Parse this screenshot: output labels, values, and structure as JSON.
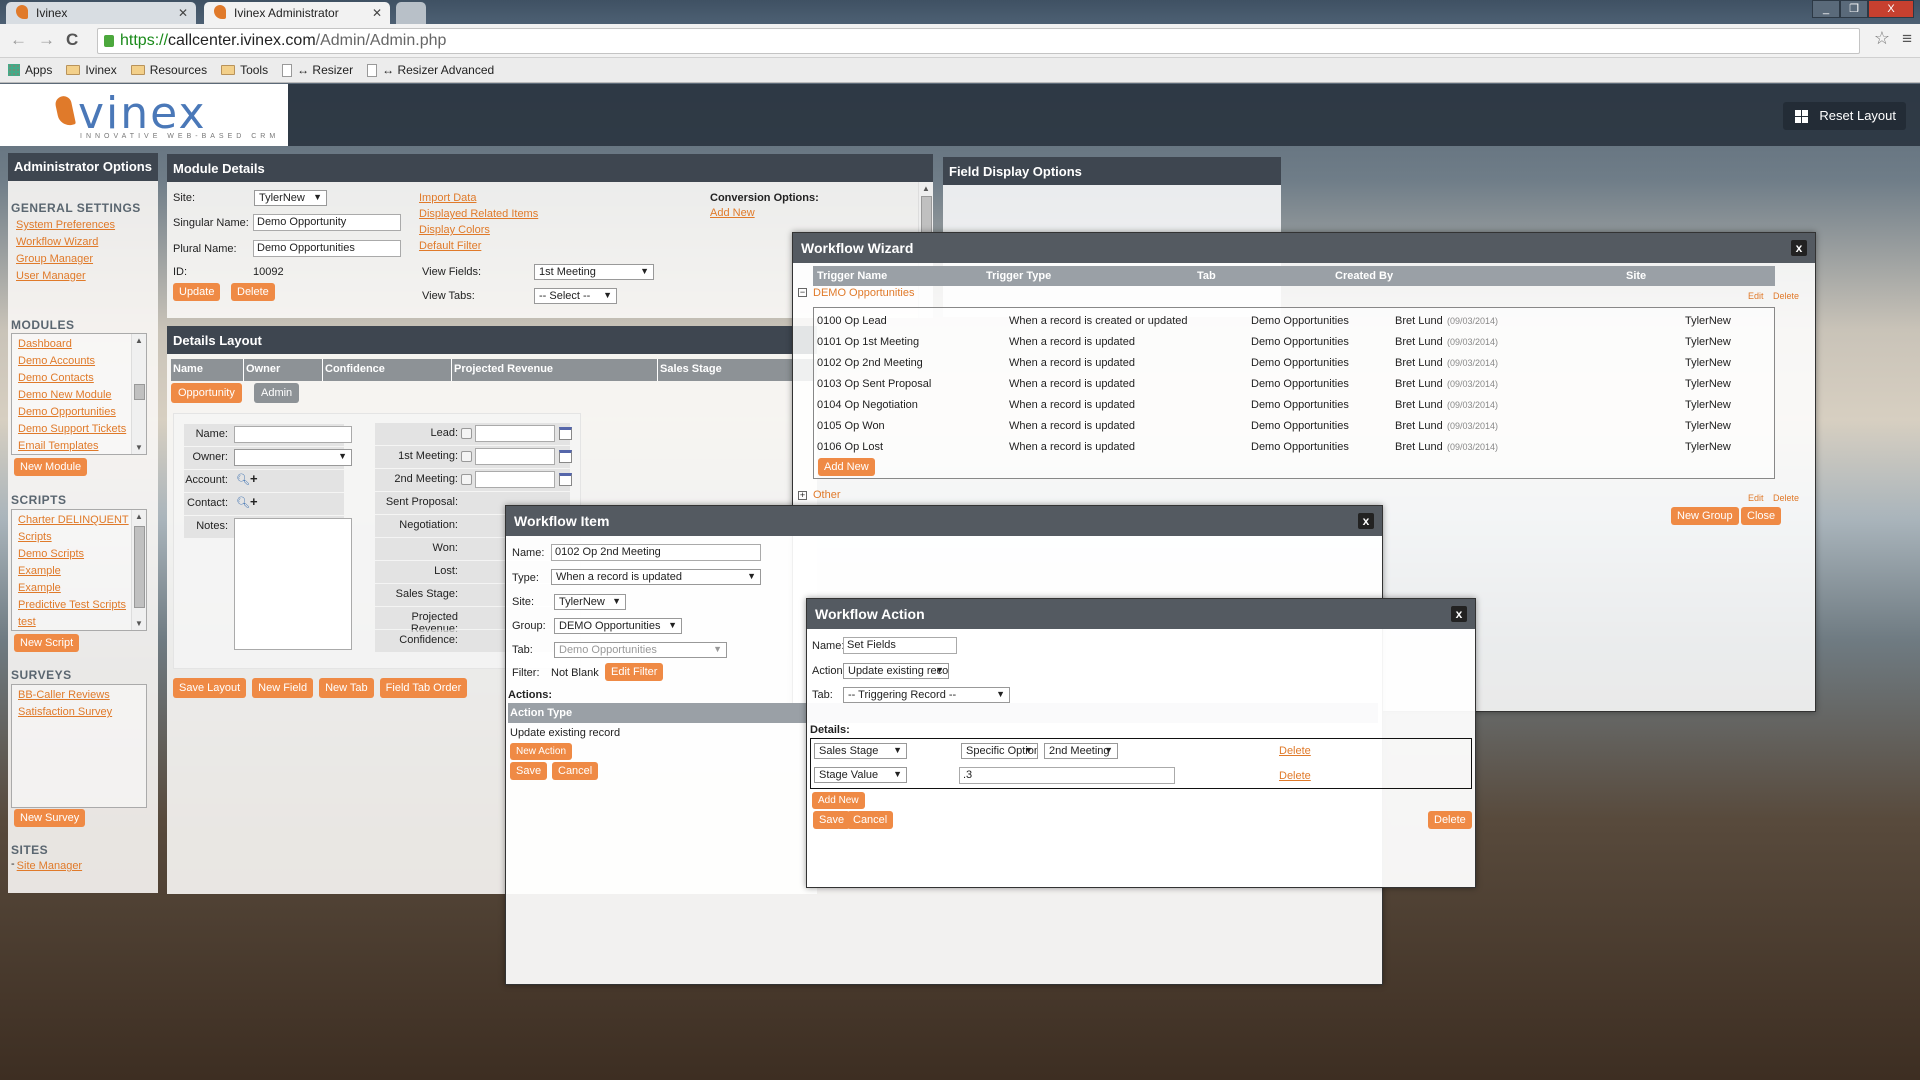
{
  "browser": {
    "tabs": [
      {
        "title": "Ivinex",
        "active": false
      },
      {
        "title": "Ivinex Administrator",
        "active": true
      }
    ],
    "url_scheme": "https://",
    "url_host": "callcenter.ivinex.com",
    "url_path": "/Admin/Admin.php",
    "bookmarks": [
      "Apps",
      "Ivinex",
      "Resources",
      "Tools",
      "↔ Resizer",
      "↔ Resizer Advanced"
    ],
    "window_buttons": [
      "_",
      "❐",
      "X"
    ]
  },
  "header": {
    "logo_word": "vinex",
    "logo_tagline": "INNOVATIVE WEB-BASED CRM",
    "reset_layout": "Reset Layout"
  },
  "sidebar": {
    "title": "Administrator Options",
    "general_title": "GENERAL SETTINGS",
    "general": [
      "System Preferences",
      "Workflow Wizard",
      "Group Manager",
      "User Manager"
    ],
    "modules_title": "MODULES",
    "modules": [
      "Dashboard",
      "Demo Accounts",
      "Demo Contacts",
      "Demo New Module",
      "Demo Opportunities",
      "Demo Support Tickets",
      "Email Templates"
    ],
    "new_module": "New Module",
    "scripts_title": "SCRIPTS",
    "scripts": [
      "Charter DELINQUENT",
      "Scripts",
      "Demo Scripts",
      "Example",
      "Example",
      "Predictive Test Scripts",
      "test"
    ],
    "new_script": "New Script",
    "surveys_title": "SURVEYS",
    "surveys": [
      "BB-Caller Reviews",
      "Satisfaction Survey"
    ],
    "new_survey": "New Survey",
    "sites_title": "SITES",
    "sites": [
      "Site Manager"
    ]
  },
  "module_details": {
    "title": "Module Details",
    "site_label": "Site:",
    "site_value": "TylerNew",
    "singular_label": "Singular Name:",
    "singular_value": "Demo Opportunity",
    "plural_label": "Plural Name:",
    "plural_value": "Demo Opportunities",
    "id_label": "ID:",
    "id_value": "10092",
    "update": "Update",
    "delete": "Delete",
    "links": [
      "Import Data",
      "Displayed Related Items",
      "Display Colors",
      "Default Filter"
    ],
    "view_fields_label": "View Fields:",
    "view_fields_value": "1st Meeting",
    "view_tabs_label": "View Tabs:",
    "view_tabs_value": "-- Select --",
    "conversion_label": "Conversion Options:",
    "add_new": "Add New"
  },
  "details_layout": {
    "title": "Details Layout",
    "columns": [
      "Name",
      "Owner",
      "Confidence",
      "Projected Revenue",
      "Sales Stage"
    ],
    "tabs": [
      "Opportunity",
      "Admin"
    ],
    "left_fields": [
      "Name:",
      "Owner:",
      "Account:",
      "Contact:",
      "Notes:"
    ],
    "right_fields": [
      "Lead:",
      "1st Meeting:",
      "2nd Meeting:",
      "Sent Proposal:",
      "Negotiation:",
      "Won:",
      "Lost:",
      "Sales Stage:",
      "Projected Revenue:",
      "Confidence:"
    ],
    "buttons": [
      "Save Layout",
      "New Field",
      "New Tab",
      "Field Tab Order"
    ]
  },
  "field_display": {
    "title": "Field Display Options"
  },
  "workflow_wizard": {
    "title": "Workflow Wizard",
    "columns": [
      "Trigger Name",
      "Trigger Type",
      "Tab",
      "Created By",
      "Site"
    ],
    "group": "DEMO Opportunities",
    "edit": "Edit",
    "delete": "Delete",
    "rows": [
      {
        "name": "0100 Op Lead",
        "type": "When a record is created or updated",
        "tab": "Demo Opportunities",
        "by": "Bret Lund",
        "date": "(09/03/2014)",
        "site": "TylerNew"
      },
      {
        "name": "0101 Op 1st Meeting",
        "type": "When a record is updated",
        "tab": "Demo Opportunities",
        "by": "Bret Lund",
        "date": "(09/03/2014)",
        "site": "TylerNew"
      },
      {
        "name": "0102 Op 2nd Meeting",
        "type": "When a record is updated",
        "tab": "Demo Opportunities",
        "by": "Bret Lund",
        "date": "(09/03/2014)",
        "site": "TylerNew"
      },
      {
        "name": "0103 Op Sent Proposal",
        "type": "When a record is updated",
        "tab": "Demo Opportunities",
        "by": "Bret Lund",
        "date": "(09/03/2014)",
        "site": "TylerNew"
      },
      {
        "name": "0104 Op Negotiation",
        "type": "When a record is updated",
        "tab": "Demo Opportunities",
        "by": "Bret Lund",
        "date": "(09/03/2014)",
        "site": "TylerNew"
      },
      {
        "name": "0105 Op Won",
        "type": "When a record is updated",
        "tab": "Demo Opportunities",
        "by": "Bret Lund",
        "date": "(09/03/2014)",
        "site": "TylerNew"
      },
      {
        "name": "0106 Op Lost",
        "type": "When a record is updated",
        "tab": "Demo Opportunities",
        "by": "Bret Lund",
        "date": "(09/03/2014)",
        "site": "TylerNew"
      }
    ],
    "add_new": "Add New",
    "other_group": "Other",
    "new_group": "New Group",
    "close": "Close"
  },
  "workflow_item": {
    "title": "Workflow Item",
    "name_label": "Name:",
    "name_value": "0102 Op 2nd Meeting",
    "type_label": "Type:",
    "type_value": "When a record is updated",
    "site_label": "Site:",
    "site_value": "TylerNew",
    "group_label": "Group:",
    "group_value": "DEMO Opportunities",
    "tab_label": "Tab:",
    "tab_value": "Demo Opportunities",
    "filter_label": "Filter:",
    "filter_value": "Not Blank",
    "edit_filter": "Edit Filter",
    "actions_label": "Actions:",
    "action_type_header": "Action Type",
    "actions": [
      "Update existing record"
    ],
    "new_action": "New Action",
    "save": "Save",
    "cancel": "Cancel"
  },
  "workflow_action": {
    "title": "Workflow Action",
    "name_label": "Name:",
    "name_value": "Set Fields",
    "action_label": "Action:",
    "action_value": "Update existing record",
    "tab_label": "Tab:",
    "tab_value": "-- Triggering Record --",
    "details_label": "Details:",
    "details": [
      {
        "field": "Sales Stage",
        "mode": "Specific Option",
        "value": "2nd Meeting",
        "delete": "Delete"
      },
      {
        "field": "Stage Value",
        "input": ".3",
        "delete": "Delete"
      }
    ],
    "add_new": "Add New",
    "save": "Save",
    "cancel": "Cancel",
    "delete": "Delete"
  },
  "colors": {
    "accent": "#ef8a45",
    "header": "#3e4650",
    "link": "#e07a2a"
  }
}
